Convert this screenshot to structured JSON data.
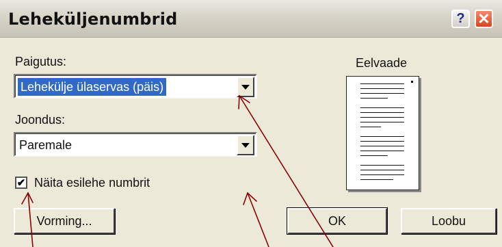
{
  "dialog": {
    "title": "Leheküljenumbrid",
    "help_symbol": "?",
    "close_symbol": "✕"
  },
  "position": {
    "label": "Paigutus:",
    "value": "Lehekülje ülaservas (päis)"
  },
  "alignment": {
    "label": "Joondus:",
    "value": "Paremale"
  },
  "show_first_page": {
    "label": "Näita esilehe numbrit",
    "checked": true,
    "check_glyph": "✔"
  },
  "preview": {
    "label": "Eelvaade"
  },
  "buttons": {
    "format": "Vorming...",
    "ok": "OK",
    "cancel": "Loobu"
  },
  "colors": {
    "annotation": "#8b0000",
    "dialog_bg": "#ece9d8",
    "selection": "#316ac5"
  }
}
